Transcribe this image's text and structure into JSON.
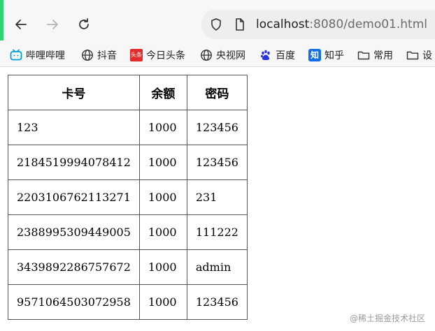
{
  "browser": {
    "back_icon": "back-arrow-icon",
    "forward_icon": "forward-arrow-icon",
    "reload_icon": "reload-icon",
    "shield_icon": "shield-icon",
    "page_icon": "page-icon",
    "url_host": "localhost",
    "url_rest": ":8080/demo01.html",
    "accent_color": "#2ed573"
  },
  "bookmarks": [
    {
      "label": "哔哩哔哩",
      "icon": "bilibili-icon"
    },
    {
      "label": "抖音",
      "icon": "globe-icon"
    },
    {
      "label": "今日头条",
      "icon": "toutiao-icon",
      "badge": "头条"
    },
    {
      "label": "央视网",
      "icon": "globe-icon"
    },
    {
      "label": "百度",
      "icon": "baidu-paw-icon"
    },
    {
      "label": "知乎",
      "icon": "zhihu-icon",
      "badge": "知"
    },
    {
      "label": "常用",
      "icon": "folder-icon"
    },
    {
      "label": "设",
      "icon": "folder-icon"
    }
  ],
  "table": {
    "headers": [
      "卡号",
      "余额",
      "密码"
    ],
    "rows": [
      [
        "123",
        "1000",
        "123456"
      ],
      [
        "2184519994078412",
        "1000",
        "123456"
      ],
      [
        "2203106762113271",
        "1000",
        "231"
      ],
      [
        "2388995309449005",
        "1000",
        "111222"
      ],
      [
        "3439892286757672",
        "1000",
        "admin"
      ],
      [
        "9571064503072958",
        "1000",
        "123456"
      ]
    ]
  },
  "watermark": "@稀土掘金技术社区"
}
